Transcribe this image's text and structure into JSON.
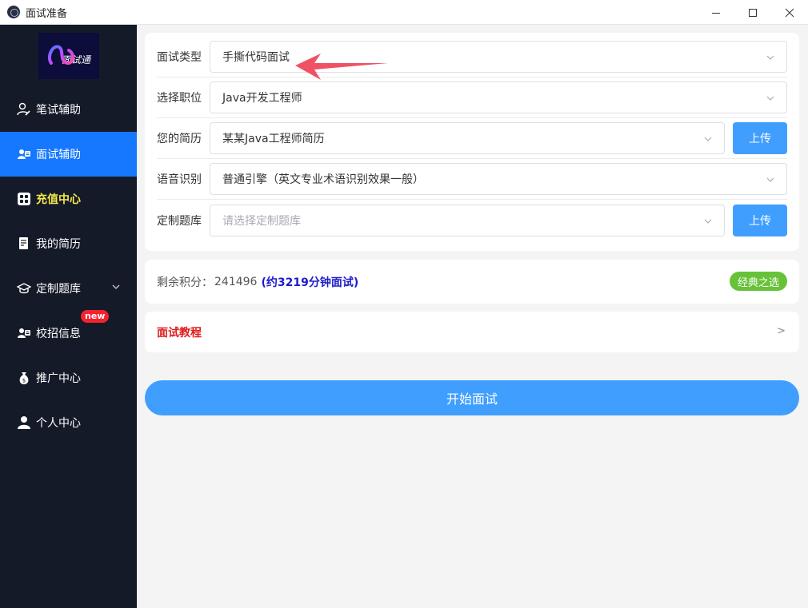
{
  "window": {
    "title": "面试准备",
    "minimize_label": "—",
    "maximize_label": "☐",
    "close_label": "✕"
  },
  "sidebar": {
    "logo_text": "面试通",
    "items": [
      {
        "label": "笔试辅助",
        "icon": "person-edit-icon"
      },
      {
        "label": "面试辅助",
        "icon": "person-card-icon",
        "active": true
      },
      {
        "label": "充值中心",
        "icon": "grid-icon",
        "highlight": true
      },
      {
        "label": "我的简历",
        "icon": "document-icon"
      },
      {
        "label": "定制题库",
        "icon": "graduation-cap-icon",
        "expandable": true
      },
      {
        "label": "校招信息",
        "icon": "person-card-icon",
        "badge": "new"
      },
      {
        "label": "推广中心",
        "icon": "money-bag-icon"
      },
      {
        "label": "个人中心",
        "icon": "user-icon"
      }
    ]
  },
  "form": {
    "interview_type": {
      "label": "面试类型",
      "value": "手撕代码面试"
    },
    "position": {
      "label": "选择职位",
      "value": "Java开发工程师"
    },
    "resume": {
      "label": "您的简历",
      "value": "某某Java工程师简历",
      "upload_label": "上传"
    },
    "speech": {
      "label": "语音识别",
      "value": "普通引擎（英文专业术语识别效果一般）"
    },
    "question_bank": {
      "label": "定制题库",
      "placeholder": "请选择定制题库",
      "upload_label": "上传"
    }
  },
  "points": {
    "label": "剩余积分：",
    "value": "241496",
    "estimate": "(约3219分钟面试)",
    "classic_label": "经典之选"
  },
  "tutorial": {
    "label": "面试教程",
    "arrow": ">"
  },
  "start_button": "开始面试",
  "colors": {
    "sidebar_bg": "#151a29",
    "active": "#1677ff",
    "primary": "#409eff",
    "highlight": "#f5e84a",
    "badge": "#f5222d",
    "success": "#67c23a",
    "tutorial": "#e01b1b",
    "annotation": "#f05265"
  }
}
